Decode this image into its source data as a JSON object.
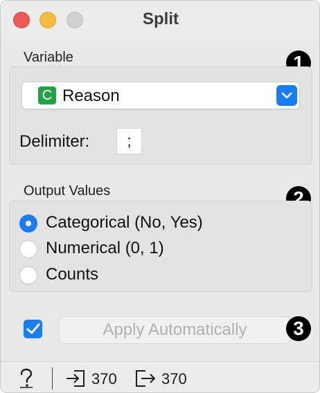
{
  "window": {
    "title": "Split"
  },
  "variable_section": {
    "label": "Variable",
    "badge": "1",
    "variable": {
      "type_letter": "C",
      "value": "Reason"
    },
    "delimiter": {
      "label": "Delimiter:",
      "value": ";"
    }
  },
  "output_section": {
    "label": "Output Values",
    "badge": "2",
    "options": [
      {
        "label": "Categorical (No, Yes)",
        "selected": true
      },
      {
        "label": "Numerical (0, 1)",
        "selected": false
      },
      {
        "label": "Counts",
        "selected": false
      }
    ]
  },
  "apply": {
    "badge": "3",
    "checked": true,
    "label": "Apply Automatically"
  },
  "status": {
    "input_count": "370",
    "output_count": "370"
  },
  "colors": {
    "accent": "#1a7df2",
    "categorical_icon": "#23a144"
  }
}
